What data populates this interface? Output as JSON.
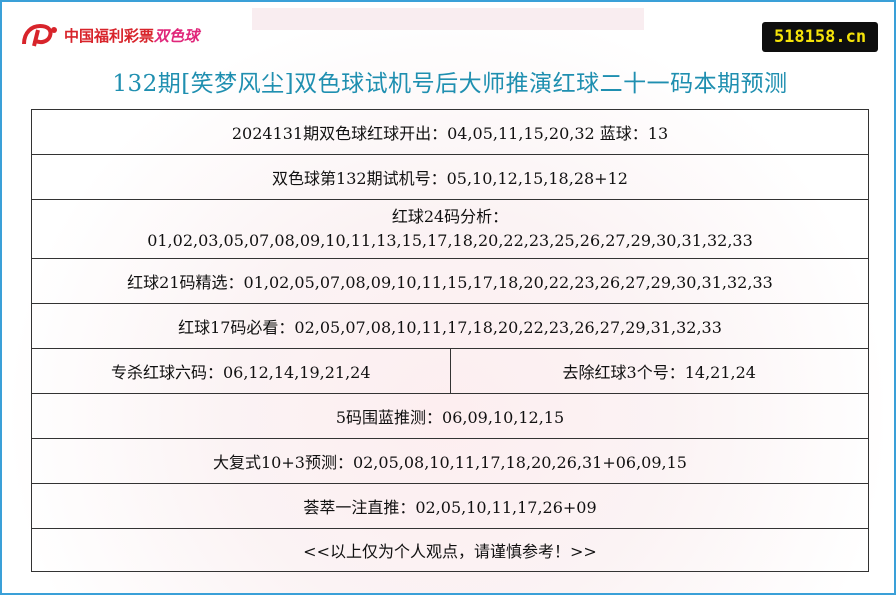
{
  "header": {
    "logo_text": "中国福利彩票",
    "logo_game": "双色球",
    "site_badge": "518158.cn",
    "title": "132期[笑梦风尘]双色球试机号后大师推演红球二十一码本期预测"
  },
  "rows": {
    "prev_draw": "2024131期双色球红球开出：04,05,11,15,20,32 蓝球：13",
    "test_number": "双色球第132期试机号：05,10,12,15,18,28+12",
    "red24_label": "红球24码分析：",
    "red24_values": "01,02,03,05,07,08,09,10,11,13,15,17,18,20,22,23,25,26,27,29,30,31,32,33",
    "red21": "红球21码精选：01,02,05,07,08,09,10,11,15,17,18,20,22,23,26,27,29,30,31,32,33",
    "red17": "红球17码必看：02,05,07,08,10,11,17,18,20,22,23,26,27,29,31,32,33",
    "kill_six": "专杀红球六码：06,12,14,19,21,24",
    "remove_three": "去除红球3个号：14,21,24",
    "blue5": "5码围蓝推测：06,09,10,12,15",
    "big_combo": "大复式10+3预测：02,05,08,10,11,17,18,20,26,31+06,09,15",
    "single_pick": "荟萃一注直推：02,05,10,11,17,26+09",
    "disclaimer": "<<以上仅为个人观点，请谨慎参考！>>"
  },
  "colors": {
    "title": "#1f8fb0",
    "badge_bg": "#0e0e0e",
    "badge_text": "#f5e30a",
    "logo_red": "#d8242b",
    "frame_border": "#3aa0d8"
  }
}
